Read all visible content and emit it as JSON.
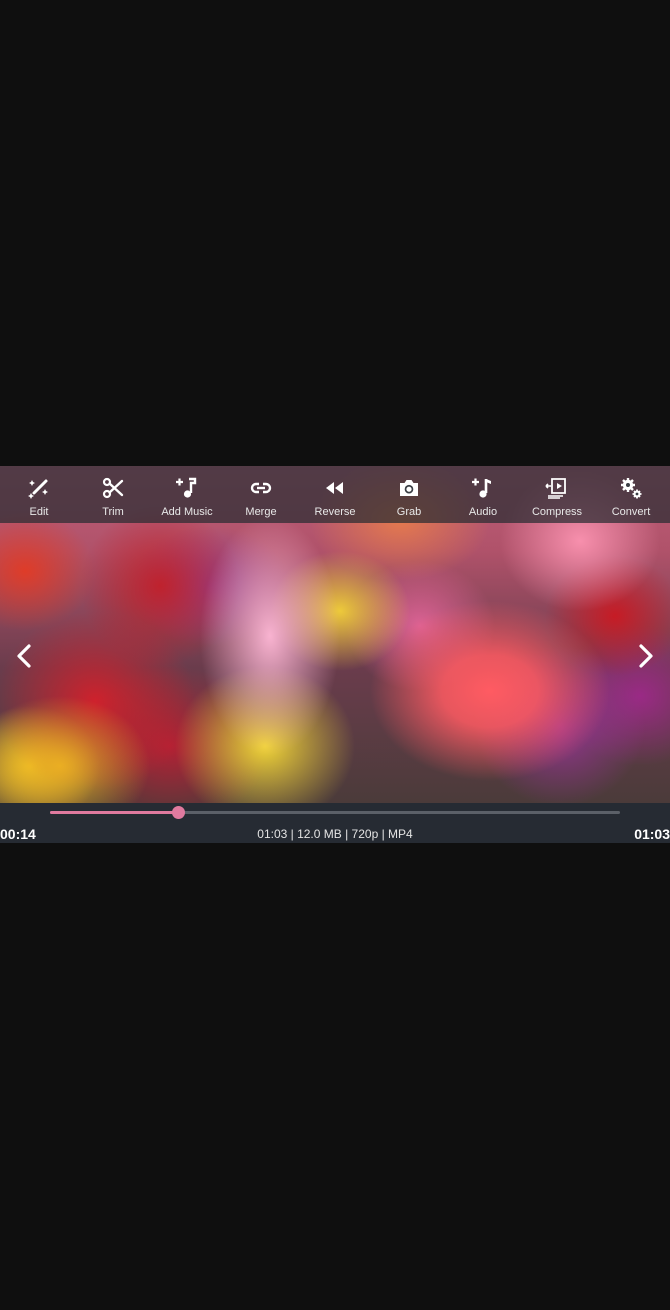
{
  "toolbar": {
    "items": [
      {
        "label": "Edit",
        "icon": "magic-wand-icon"
      },
      {
        "label": "Trim",
        "icon": "scissors-icon"
      },
      {
        "label": "Add Music",
        "icon": "music-add-icon"
      },
      {
        "label": "Merge",
        "icon": "link-icon"
      },
      {
        "label": "Reverse",
        "icon": "rewind-icon"
      },
      {
        "label": "Grab",
        "icon": "camera-icon"
      },
      {
        "label": "Audio",
        "icon": "audio-note-icon"
      },
      {
        "label": "Compress",
        "icon": "compress-icon"
      },
      {
        "label": "Convert",
        "icon": "gears-icon"
      }
    ]
  },
  "nav": {
    "prev_icon": "chevron-left-icon",
    "next_icon": "chevron-right-icon"
  },
  "playback": {
    "current_time": "00:14",
    "total_time": "01:03",
    "progress": 0.225,
    "info": "01:03 | 12.0 MB | 720p | MP4"
  },
  "colors": {
    "accent": "#e07a9f",
    "toolbar_bg": "#282c32",
    "bottom_bar_bg": "#262b33",
    "page_bg": "#0f0f0f"
  }
}
